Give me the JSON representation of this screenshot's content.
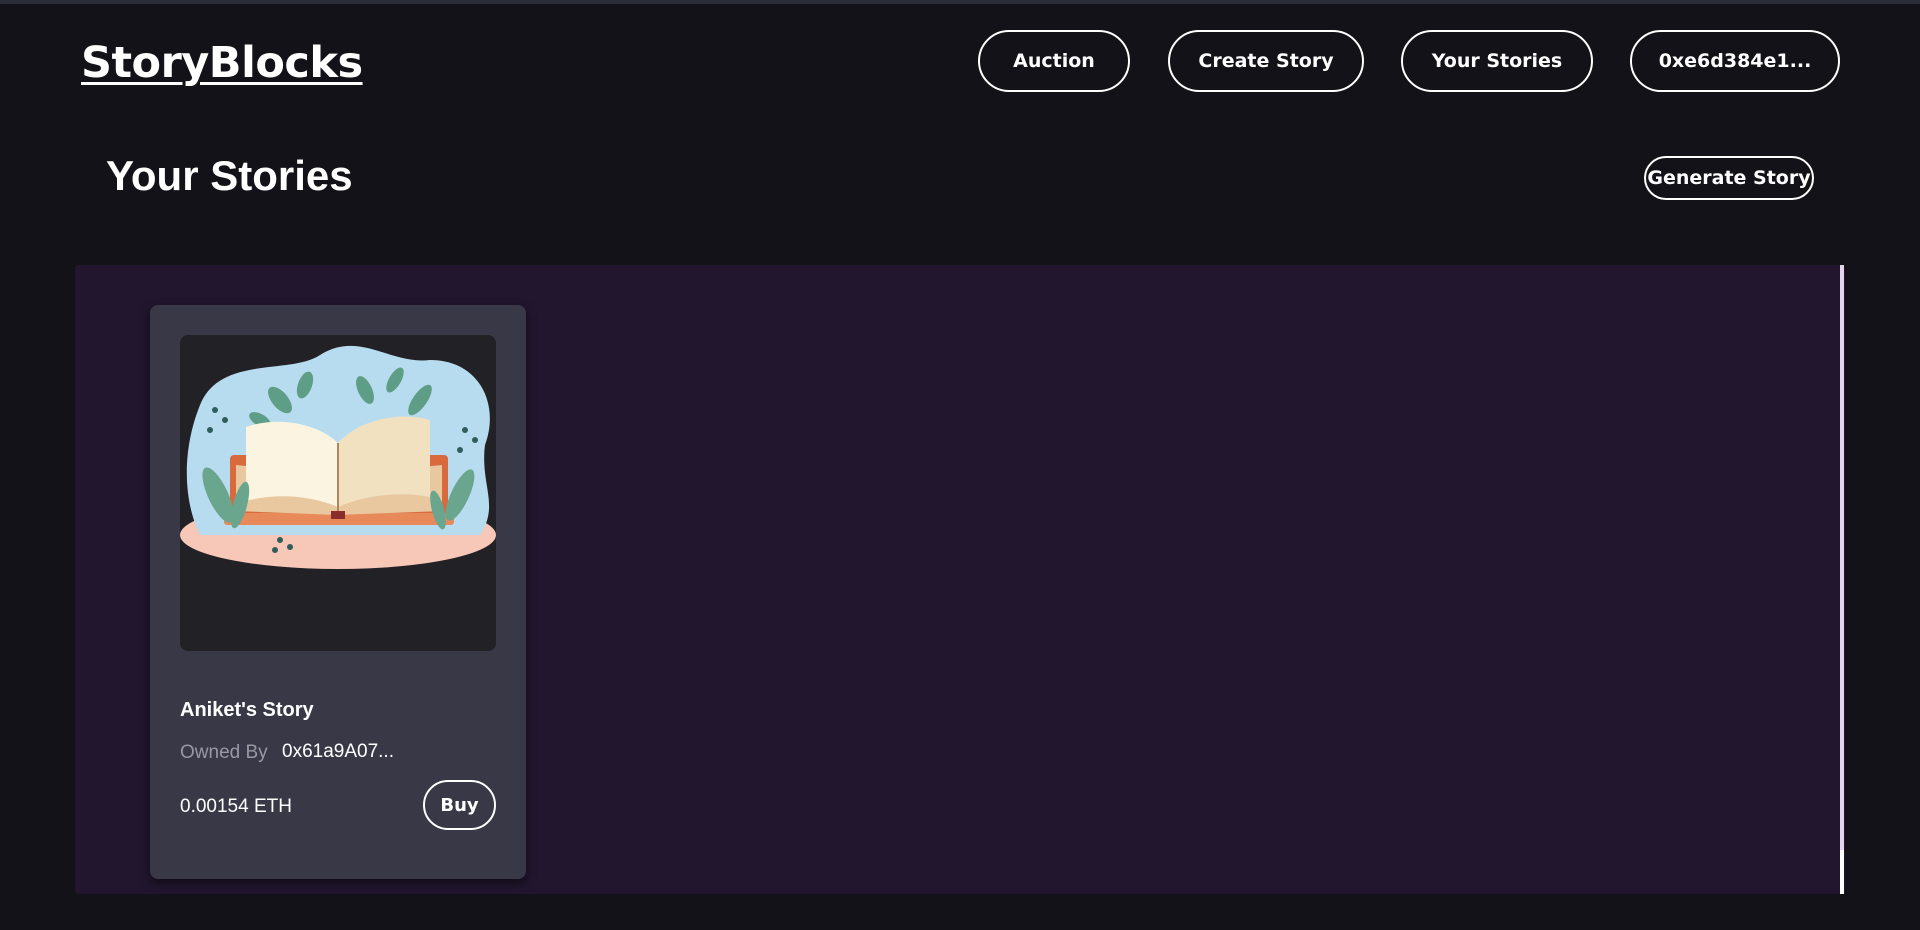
{
  "header": {
    "logo": "StoryBlocks",
    "nav": {
      "auction": "Auction",
      "create_story": "Create Story",
      "your_stories": "Your Stories",
      "wallet": "0xe6d384e1..."
    }
  },
  "page": {
    "title": "Your Stories",
    "generate_button": "Generate Story"
  },
  "stories": [
    {
      "title": "Aniket's Story",
      "owned_by_label": "Owned By",
      "owner": "0x61a9A07...",
      "price": "0.00154 ETH",
      "buy_label": "Buy",
      "image_icon": "open-book-illustration"
    }
  ],
  "colors": {
    "background": "#131218",
    "gallery": "#21162e",
    "card": "#393847",
    "accent_text": "#ffffff"
  }
}
